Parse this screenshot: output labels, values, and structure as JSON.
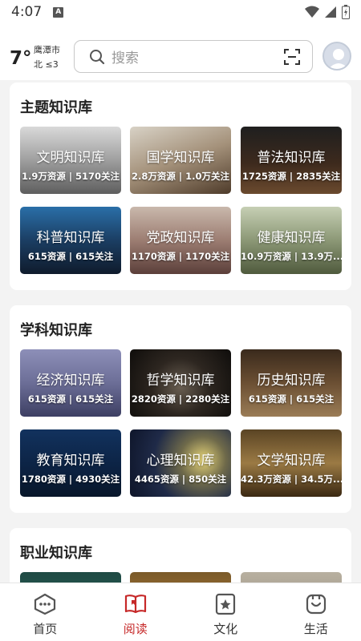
{
  "status_bar": {
    "time": "4:07",
    "app_badge": "A"
  },
  "weather": {
    "temperature": "7°",
    "city": "鹰潭市",
    "wind": "北 ≤3"
  },
  "search": {
    "placeholder": "搜索"
  },
  "sections": [
    {
      "title": "主题知识库",
      "tiles": [
        {
          "name": "文明知识库",
          "stats": "1.9万资源 | 5170关注"
        },
        {
          "name": "国学知识库",
          "stats": "2.8万资源 | 1.0万关注"
        },
        {
          "name": "普法知识库",
          "stats": "1725资源 | 2835关注"
        },
        {
          "name": "科普知识库",
          "stats": "615资源 | 615关注"
        },
        {
          "name": "党政知识库",
          "stats": "1170资源 | 1170关注"
        },
        {
          "name": "健康知识库",
          "stats": "10.9万资源 | 13.9万..."
        }
      ]
    },
    {
      "title": "学科知识库",
      "tiles": [
        {
          "name": "经济知识库",
          "stats": "615资源 | 615关注"
        },
        {
          "name": "哲学知识库",
          "stats": "2820资源 | 2280关注"
        },
        {
          "name": "历史知识库",
          "stats": "615资源 | 615关注"
        },
        {
          "name": "教育知识库",
          "stats": "1780资源 | 4930关注"
        },
        {
          "name": "心理知识库",
          "stats": "4465资源 | 850关注"
        },
        {
          "name": "文学知识库",
          "stats": "42.3万资源 | 34.5万..."
        }
      ]
    },
    {
      "title": "职业知识库"
    }
  ],
  "bottom_nav": [
    {
      "label": "首页",
      "icon": "home-icon",
      "active": false
    },
    {
      "label": "阅读",
      "icon": "book-icon",
      "active": true
    },
    {
      "label": "文化",
      "icon": "culture-icon",
      "active": false
    },
    {
      "label": "生活",
      "icon": "life-icon",
      "active": false
    }
  ],
  "colors": {
    "active": "#c62828",
    "inactive": "#555555",
    "background": "#f3f3f3"
  }
}
